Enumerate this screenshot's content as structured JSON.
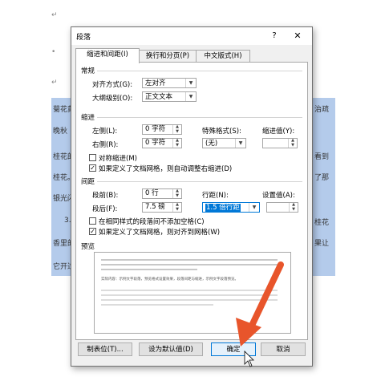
{
  "dialog": {
    "title": "段落",
    "help_label": "?",
    "close_label": "✕",
    "tabs": [
      {
        "label": "缩进和间距(I)",
        "active": true
      },
      {
        "label": "换行和分页(P)",
        "active": false
      },
      {
        "label": "中文版式(H)",
        "active": false
      }
    ],
    "general": {
      "heading": "常规",
      "alignment_label": "对齐方式(G):",
      "alignment_value": "左对齐",
      "outline_label": "大纲级别(O):",
      "outline_value": "正文文本"
    },
    "indent": {
      "heading": "缩进",
      "left_label": "左侧(L):",
      "left_value": "0 字符",
      "right_label": "右侧(R):",
      "right_value": "0 字符",
      "special_label": "特殊格式(S):",
      "special_value": "(无)",
      "by_label": "缩进值(Y):",
      "by_value": "",
      "mirror_label": "对称缩进(M)",
      "mirror_checked": false,
      "auto_adjust_label": "如果定义了文档网格，则自动调整右缩进(D)",
      "auto_adjust_checked": true
    },
    "spacing": {
      "heading": "间距",
      "before_label": "段前(B):",
      "before_value": "0 行",
      "after_label": "段后(F):",
      "after_value": "7.5 磅",
      "line_spacing_label": "行距(N):",
      "line_spacing_value": "1.5 倍行距",
      "at_label": "设置值(A):",
      "at_value": "",
      "no_space_label": "在相同样式的段落间不添加空格(C)",
      "no_space_checked": false,
      "snap_grid_label": "如果定义了文档网格，则对齐到网格(W)",
      "snap_grid_checked": true
    },
    "preview": {
      "heading": "预览",
      "sample_text": "实际内容：示例文字段落，预览格式设置效果，段落间距与缩进，示例文字段落预览。"
    },
    "buttons": {
      "tabs_label": "制表位(T)...",
      "default_label": "设为默认值(D)",
      "ok_label": "确定",
      "cancel_label": "取消"
    }
  },
  "document": {
    "lines": [
      "菊花黄",
      "晚秋",
      "桂花的",
      "桂花。",
      "银光闪",
      "3.",
      "香里的",
      "它开过"
    ],
    "right_lines": [
      "治疏",
      "看到",
      "了那",
      "桂花",
      "果让"
    ]
  },
  "colors": {
    "accent": "#0078d7",
    "arrow": "#e8552b",
    "highlight": "#b4cbeb"
  }
}
